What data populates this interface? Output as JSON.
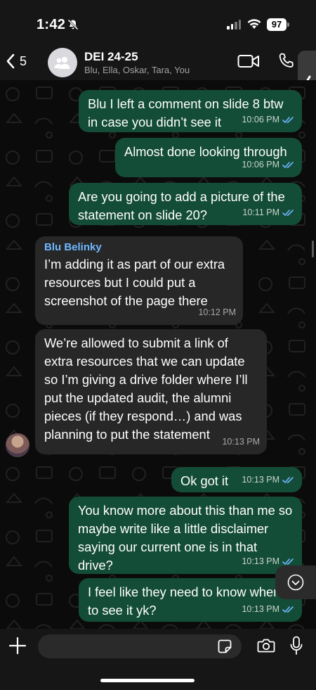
{
  "status_bar": {
    "time": "1:42",
    "battery": "97"
  },
  "header": {
    "back_count": "5",
    "group_name": "DEI 24-25",
    "members": "Blu, Ella, Oskar, Tara, You"
  },
  "messages": [
    {
      "direction": "outgoing",
      "text": "Blu I left a comment on slide 8 btw in case you didn’t see it",
      "time": "10:06 PM",
      "read": true
    },
    {
      "direction": "outgoing",
      "text": "Almost done looking through",
      "time": "10:06 PM",
      "read": true
    },
    {
      "direction": "outgoing",
      "text": "Are you going to add a picture of the statement on slide 20?",
      "time": "10:11 PM",
      "read": true
    },
    {
      "direction": "incoming",
      "sender": "Blu Belinky",
      "text": "I’m adding it as part of our extra resources but I could put a screenshot of the page there",
      "time": "10:12 PM"
    },
    {
      "direction": "incoming",
      "text": "We’re allowed to submit a link of extra resources that we can update so I’m giving a drive folder where I’ll put the updated audit, the alumni pieces (if they respond…) and was planning to put the statement",
      "time": "10:13 PM"
    },
    {
      "direction": "outgoing",
      "text": "Ok got it",
      "time": "10:13 PM",
      "read": true
    },
    {
      "direction": "outgoing",
      "text": "You know more about this than me so maybe write like a little disclaimer saying our current one is in that drive?",
      "time": "10:13 PM",
      "read": true
    },
    {
      "direction": "outgoing",
      "text": "I feel like they need to know where to see it yk?",
      "time": "10:13 PM",
      "read": true
    }
  ],
  "colors": {
    "outgoing_bubble": "#144d37",
    "incoming_bubble": "#272727",
    "sender_name": "#6fb7ff",
    "read_ticks": "#6fb7ff"
  },
  "icons": {
    "back": "chevron-left-icon",
    "group_avatar": "people-icon",
    "video": "video-camera-icon",
    "call": "phone-icon",
    "attach": "plus-icon",
    "sticker": "sticker-icon",
    "camera": "camera-icon",
    "mic": "microphone-icon",
    "scroll_down": "chevron-down-circle-icon"
  }
}
